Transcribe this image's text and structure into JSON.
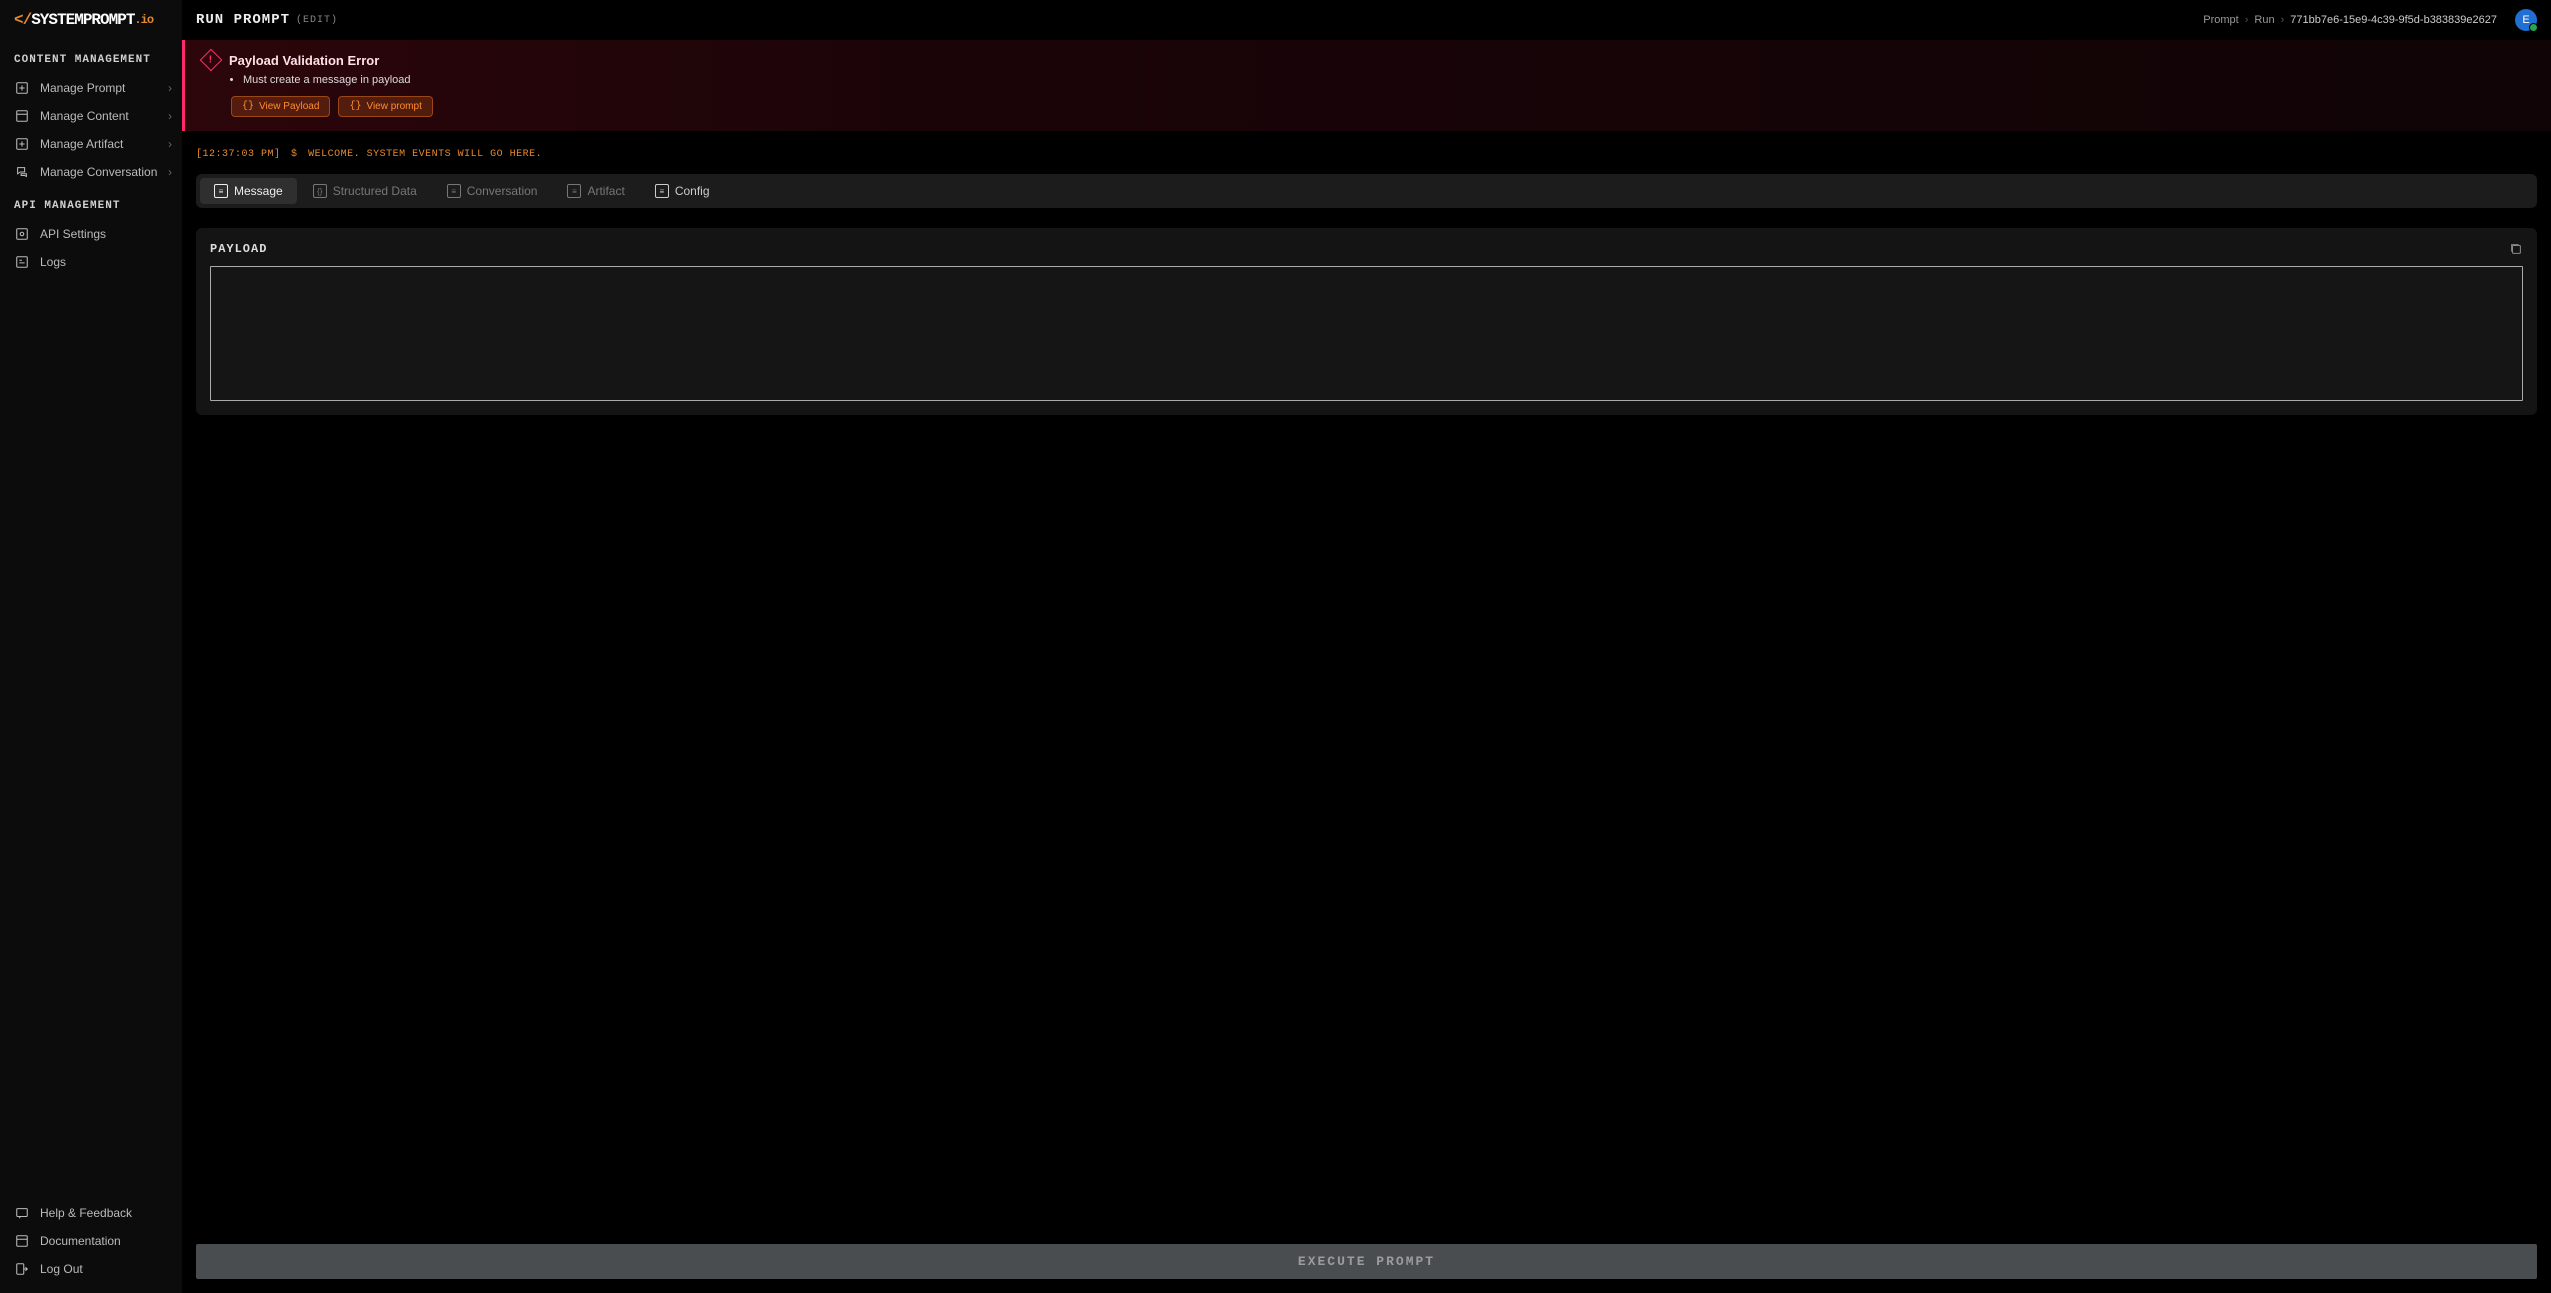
{
  "brand": {
    "prefix": "</",
    "name": "SYSTEMPROMPT",
    "suffix": ".io"
  },
  "sidebar": {
    "section1_title": "CONTENT MANAGEMENT",
    "items1": [
      {
        "label": "Manage Prompt",
        "hasChevron": true
      },
      {
        "label": "Manage Content",
        "hasChevron": true
      },
      {
        "label": "Manage Artifact",
        "hasChevron": true
      },
      {
        "label": "Manage Conversation",
        "hasChevron": true
      }
    ],
    "section2_title": "API MANAGEMENT",
    "items2": [
      {
        "label": "API Settings",
        "hasChevron": false
      },
      {
        "label": "Logs",
        "hasChevron": false
      }
    ],
    "footer": [
      {
        "label": "Help & Feedback"
      },
      {
        "label": "Documentation"
      },
      {
        "label": "Log Out"
      }
    ]
  },
  "topbar": {
    "title": "RUN PROMPT",
    "edit": "(EDIT)"
  },
  "breadcrumb": {
    "seg0": "Prompt",
    "seg1": "Run",
    "seg2": "771bb7e6-15e9-4c39-9f5d-b383839e2627"
  },
  "avatar": {
    "initial": "E"
  },
  "error": {
    "title": "Payload Validation Error",
    "items": [
      "Must create a message in payload"
    ],
    "actions": [
      "View Payload",
      "View prompt"
    ]
  },
  "eventlog": {
    "timestamp": "[12:37:03 PM]",
    "dollar": "$",
    "message": "WELCOME. SYSTEM EVENTS WILL GO HERE."
  },
  "tabs": [
    {
      "label": "Message",
      "active": true,
      "enabled": true
    },
    {
      "label": "Structured Data",
      "active": false,
      "enabled": false
    },
    {
      "label": "Conversation",
      "active": false,
      "enabled": false
    },
    {
      "label": "Artifact",
      "active": false,
      "enabled": false
    },
    {
      "label": "Config",
      "active": false,
      "enabled": true
    }
  ],
  "payload": {
    "title": "PAYLOAD",
    "content": ""
  },
  "execute_label": "EXECUTE PROMPT"
}
